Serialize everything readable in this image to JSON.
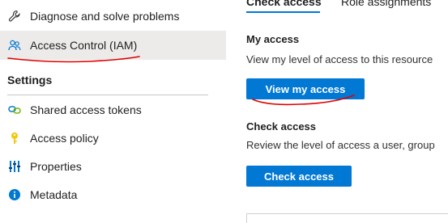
{
  "sidebar": {
    "items": [
      {
        "label": "Diagnose and solve problems",
        "icon": "wrench-icon"
      },
      {
        "label": "Access Control (IAM)",
        "icon": "people-icon",
        "selected": true
      }
    ],
    "settings_heading": "Settings",
    "settings_items": [
      {
        "label": "Shared access tokens",
        "icon": "link-chain-icon"
      },
      {
        "label": "Access policy",
        "icon": "key-icon"
      },
      {
        "label": "Properties",
        "icon": "properties-bars-icon"
      },
      {
        "label": "Metadata",
        "icon": "info-icon"
      }
    ]
  },
  "main": {
    "tabs": [
      {
        "label": "Check access",
        "active": true
      },
      {
        "label": "Role assignments",
        "active": false
      }
    ],
    "my_access": {
      "title": "My access",
      "description": "View my level of access to this resource",
      "button_label": "View my access"
    },
    "check_access": {
      "title": "Check access",
      "description": "Review the level of access a user, group",
      "button_label": "Check access"
    }
  },
  "colors": {
    "accent": "#0078d4",
    "selected_bg": "#edebe9",
    "annotation": "#e00000"
  }
}
